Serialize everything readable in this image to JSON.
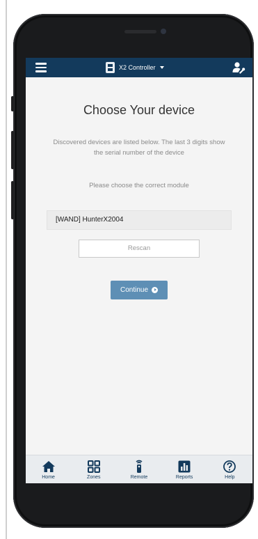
{
  "header": {
    "menu_icon": "hamburger-menu-icon",
    "controller_name": "X2 Controller",
    "controller_icon": "controller-device-icon",
    "settings_icon": "user-settings-icon",
    "bar_color": "#133a5c"
  },
  "main": {
    "title": "Choose Your device",
    "description": "Discovered devices are listed below. The last 3 digits show the serial number of the device",
    "instruction": "Please choose the correct module",
    "devices": [
      {
        "label": "[WAND] HunterX2004"
      }
    ],
    "rescan_label": "Rescan",
    "continue_label": "Continue",
    "continue_color": "#5e8fb5"
  },
  "bottom_nav": {
    "items": [
      {
        "label": "Home",
        "icon": "home-icon"
      },
      {
        "label": "Zones",
        "icon": "zones-grid-icon"
      },
      {
        "label": "Remote",
        "icon": "remote-icon"
      },
      {
        "label": "Reports",
        "icon": "reports-chart-icon"
      },
      {
        "label": "Help",
        "icon": "help-icon"
      }
    ]
  }
}
